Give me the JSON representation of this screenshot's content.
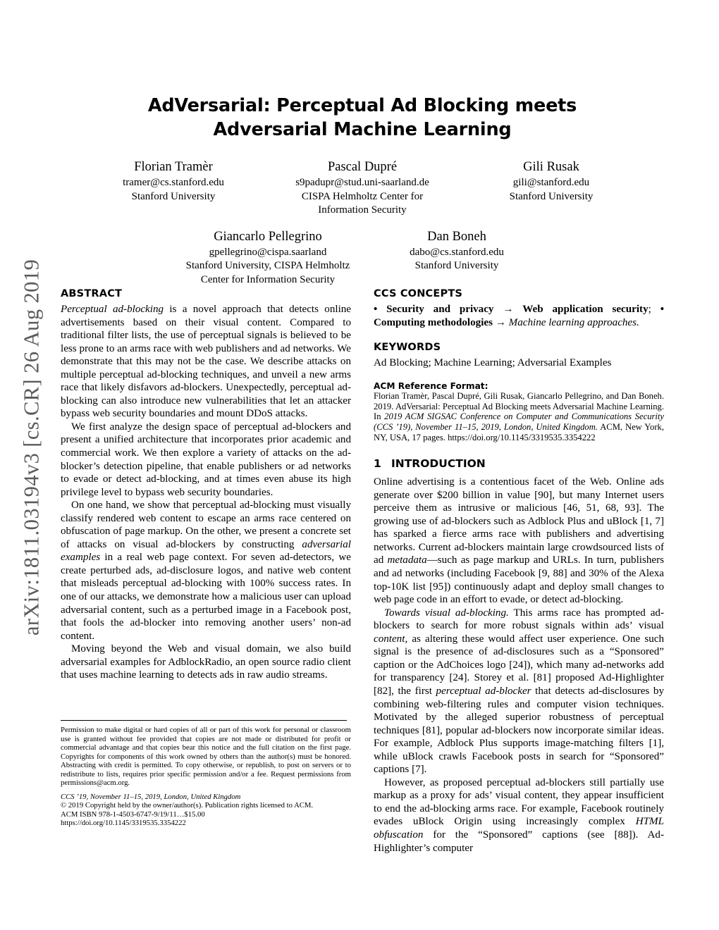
{
  "arxiv_stamp": "arXiv:1811.03194v3  [cs.CR]  26 Aug 2019",
  "title": {
    "line1": "AdVersarial: Perceptual Ad Blocking meets",
    "line2": "Adversarial Machine Learning"
  },
  "authors": [
    {
      "name": "Florian Tramèr",
      "email": "tramer@cs.stanford.edu",
      "affiliation_line1": "Stanford University",
      "affiliation_line2": ""
    },
    {
      "name": "Pascal Dupré",
      "email": "s9padupr@stud.uni-saarland.de",
      "affiliation_line1": "CISPA Helmholtz Center for",
      "affiliation_line2": "Information Security"
    },
    {
      "name": "Gili Rusak",
      "email": "gili@stanford.edu",
      "affiliation_line1": "Stanford University",
      "affiliation_line2": ""
    },
    {
      "name": "Giancarlo Pellegrino",
      "email": "gpellegrino@cispa.saarland",
      "affiliation_line1": "Stanford University, CISPA Helmholtz",
      "affiliation_line2": "Center for Information Security"
    },
    {
      "name": "Dan Boneh",
      "email": "dabo@cs.stanford.edu",
      "affiliation_line1": "Stanford University",
      "affiliation_line2": ""
    }
  ],
  "abstract": {
    "heading": "ABSTRACT",
    "para1_lead_italic": "Perceptual ad-blocking",
    "para1_rest": " is a novel approach that detects online advertisements based on their visual content. Compared to traditional filter lists, the use of perceptual signals is believed to be less prone to an arms race with web publishers and ad networks. We demonstrate that this may not be the case. We describe attacks on multiple perceptual ad-blocking techniques, and unveil a new arms race that likely disfavors ad-blockers. Unexpectedly, perceptual ad-blocking can also introduce new vulnerabilities that let an attacker bypass web security boundaries and mount DDoS attacks.",
    "para2": "We first analyze the design space of perceptual ad-blockers and present a unified architecture that incorporates prior academic and commercial work. We then explore a variety of attacks on the ad-blocker’s detection pipeline, that enable publishers or ad networks to evade or detect ad-blocking, and at times even abuse its high privilege level to bypass web security boundaries.",
    "para3_a": "On one hand, we show that perceptual ad-blocking must visually classify rendered web content to escape an arms race centered on obfuscation of page markup. On the other, we present a concrete set of attacks on visual ad-blockers by constructing ",
    "para3_italic1": "adversarial examples",
    "para3_b": " in a real web page context. For seven ad-detectors, we create perturbed ads, ad-disclosure logos, and native web content that misleads perceptual ad-blocking with 100% success rates. In one of our attacks, we demonstrate how a malicious user can upload adversarial content, such as a perturbed image in a Facebook post, that fools the ad-blocker into removing another users’ non-ad content.",
    "para4": "Moving beyond the Web and visual domain, we also build adversarial examples for AdblockRadio, an open source radio client that uses machine learning to detects ads in raw audio streams."
  },
  "ccs": {
    "heading": "CCS CONCEPTS",
    "bullet": "•",
    "part1_bold": "Security and privacy",
    "arrow": "→",
    "part2_bold": "Web application security",
    "semicolon": ";",
    "part3_bold": "Computing methodologies",
    "part4_italic": "Machine learning approaches."
  },
  "keywords": {
    "heading": "KEYWORDS",
    "text": "Ad Blocking; Machine Learning; Adversarial Examples"
  },
  "acm_reference": {
    "heading": "ACM Reference Format:",
    "part1": "Florian Tramèr, Pascal Dupré, Gili Rusak, Giancarlo Pellegrino, and Dan Boneh. 2019. AdVersarial: Perceptual Ad Blocking meets Adversarial Machine Learning. In ",
    "venue_italic": "2019 ACM SIGSAC Conference on Computer and Communications Security (CCS ’19), November 11–15, 2019, London, United Kingdom.",
    "part2": " ACM, New York, NY, USA, 17 pages. https://doi.org/10.1145/3319535.3354222"
  },
  "introduction": {
    "number": "1",
    "heading": "INTRODUCTION",
    "para1": "Online advertising is a contentious facet of the Web. Online ads generate over $200 billion in value [90], but many Internet users perceive them as intrusive or malicious [46, 51, 68, 93]. The growing use of ad-blockers such as Adblock Plus and uBlock [1, 7] has sparked a fierce arms race with publishers and advertising networks. Current ad-blockers maintain large crowdsourced lists of ad ",
    "para1_italic": "metadata",
    "para1_b": "—such as page markup and URLs. In turn, publishers and ad networks (including Facebook [9, 88] and 30% of the Alexa top-10K list [95]) continuously adapt and deploy small changes to web page code in an effort to evade, or detect ad-blocking.",
    "para2_italic": "Towards visual ad-blocking.",
    "para2_a": " This arms race has prompted ad-blockers to search for more robust signals within ads’ visual ",
    "para2_italic2": "content",
    "para2_b": ", as altering these would affect user experience. One such signal is the presence of ad-disclosures such as a “Sponsored” caption or the AdChoices logo [24]), which many ad-networks add for transparency [24]. Storey et al. [81] proposed Ad-Highlighter [82], the first ",
    "para2_italic3": "perceptual ad-blocker",
    "para2_c": " that detects ad-disclosures by combining web-filtering rules and computer vision techniques. Motivated by the alleged superior robustness of perceptual techniques [81], popular ad-blockers now incorporate similar ideas. For example, Adblock Plus supports image-matching filters [1], while uBlock crawls Facebook posts in search for “Sponsored” captions [7].",
    "para3_a": "However, as proposed perceptual ad-blockers still partially use markup as a proxy for ads’ visual content, they appear insufficient to end the ad-blocking arms race. For example, Facebook routinely evades uBlock Origin using increasingly complex ",
    "para3_italic": "HTML obfuscation",
    "para3_b": " for the “Sponsored” captions (see [88]). Ad-Highlighter’s computer"
  },
  "copyright": {
    "permission": "Permission to make digital or hard copies of all or part of this work for personal or classroom use is granted without fee provided that copies are not made or distributed for profit or commercial advantage and that copies bear this notice and the full citation on the first page. Copyrights for components of this work owned by others than the author(s) must be honored. Abstracting with credit is permitted. To copy otherwise, or republish, to post on servers or to redistribute to lists, requires prior specific permission and/or a fee. Request permissions from permissions@acm.org.",
    "venue": "CCS ’19, November 11–15, 2019, London, United Kingdom",
    "rights": "© 2019 Copyright held by the owner/author(s). Publication rights licensed to ACM.",
    "isbn": "ACM ISBN 978-1-4503-6747-9/19/11…$15.00",
    "doi": "https://doi.org/10.1145/3319535.3354222"
  }
}
